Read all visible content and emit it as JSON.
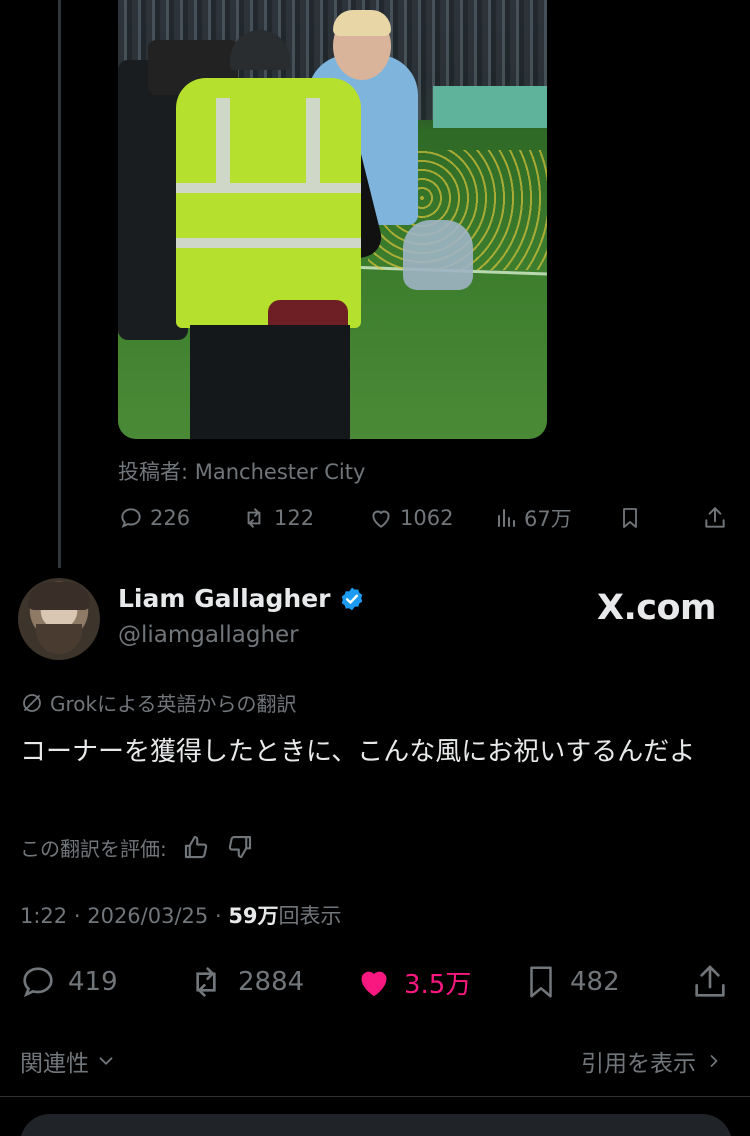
{
  "quoted_post": {
    "source_label": "投稿者: Manchester City",
    "actions": {
      "replies": "226",
      "reposts": "122",
      "likes": "1062",
      "views": "67万"
    }
  },
  "post": {
    "author_name": "Liam Gallagher",
    "author_handle": "@liamgallagher",
    "site_badge": "X.com",
    "translation_note": "Grokによる英語からの翻訳",
    "body": "コーナーを獲得したときに、こんな風にお祝いするんだよ",
    "rate_label": "この翻訳を評価:",
    "meta": {
      "time": "1:22",
      "date": "2026/03/25",
      "views_value": "59万",
      "views_suffix": "回表示"
    },
    "actions": {
      "replies": "419",
      "reposts": "2884",
      "likes": "3.5万",
      "bookmarks": "482"
    }
  },
  "footer": {
    "related_label": "関連性",
    "quotes_label": "引用を表示"
  },
  "colors": {
    "background": "#000000",
    "text": "#e7e9ea",
    "muted": "#71767b",
    "like": "#f91880",
    "verified": "#1d9bf0"
  }
}
